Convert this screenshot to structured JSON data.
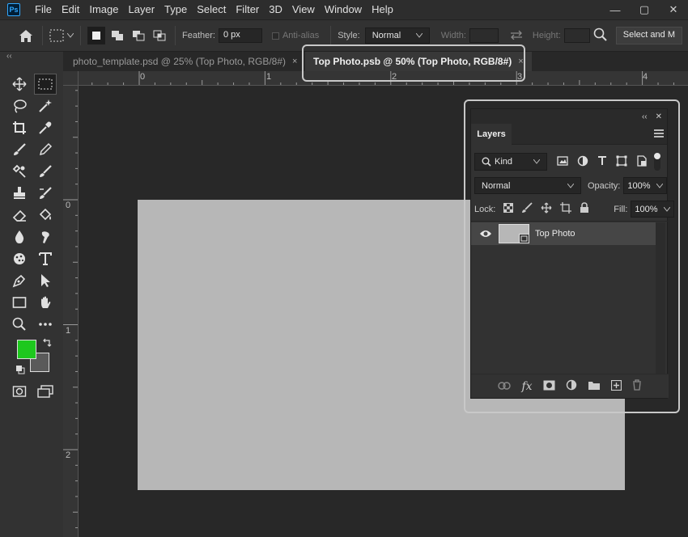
{
  "app": {
    "logo": "Ps"
  },
  "menu": [
    "File",
    "Edit",
    "Image",
    "Layer",
    "Type",
    "Select",
    "Filter",
    "3D",
    "View",
    "Window",
    "Help"
  ],
  "window_controls": {
    "minimize": "—",
    "maximize": "▢",
    "close": "✕"
  },
  "options": {
    "feather_label": "Feather:",
    "feather_value": "0 px",
    "antialias_label": "Anti-alias",
    "style_label": "Style:",
    "style_value": "Normal",
    "width_label": "Width:",
    "height_label": "Height:",
    "select_mask_label": "Select and M"
  },
  "tabs": [
    {
      "label": "photo_template.psd @ 25% (Top Photo, RGB/8#)",
      "active": false,
      "close": "×"
    },
    {
      "label": "Top Photo.psb @ 50% (Top Photo, RGB/8#)",
      "active": true,
      "close": "×"
    }
  ],
  "rulers": {
    "top": [
      "0",
      "1",
      "2",
      "3",
      "4"
    ],
    "left": [
      "0",
      "1",
      "2"
    ]
  },
  "colors": {
    "foreground": "#1ec81e",
    "background": "#5a5a5a",
    "document": "#b7b7b7",
    "accent": "#31a8ff"
  },
  "layers_panel": {
    "title": "Layers",
    "filter_kind": "Kind",
    "blend_mode": "Normal",
    "opacity_label": "Opacity:",
    "opacity_value": "100%",
    "lock_label": "Lock:",
    "fill_label": "Fill:",
    "fill_value": "100%",
    "layers": [
      {
        "name": "Top Photo",
        "visible": true,
        "type": "smart-object"
      }
    ],
    "footer_icons": [
      "link-icon",
      "fx-icon",
      "mask-icon",
      "adjustment-icon",
      "folder-icon",
      "new-layer-icon",
      "trash-icon"
    ]
  }
}
